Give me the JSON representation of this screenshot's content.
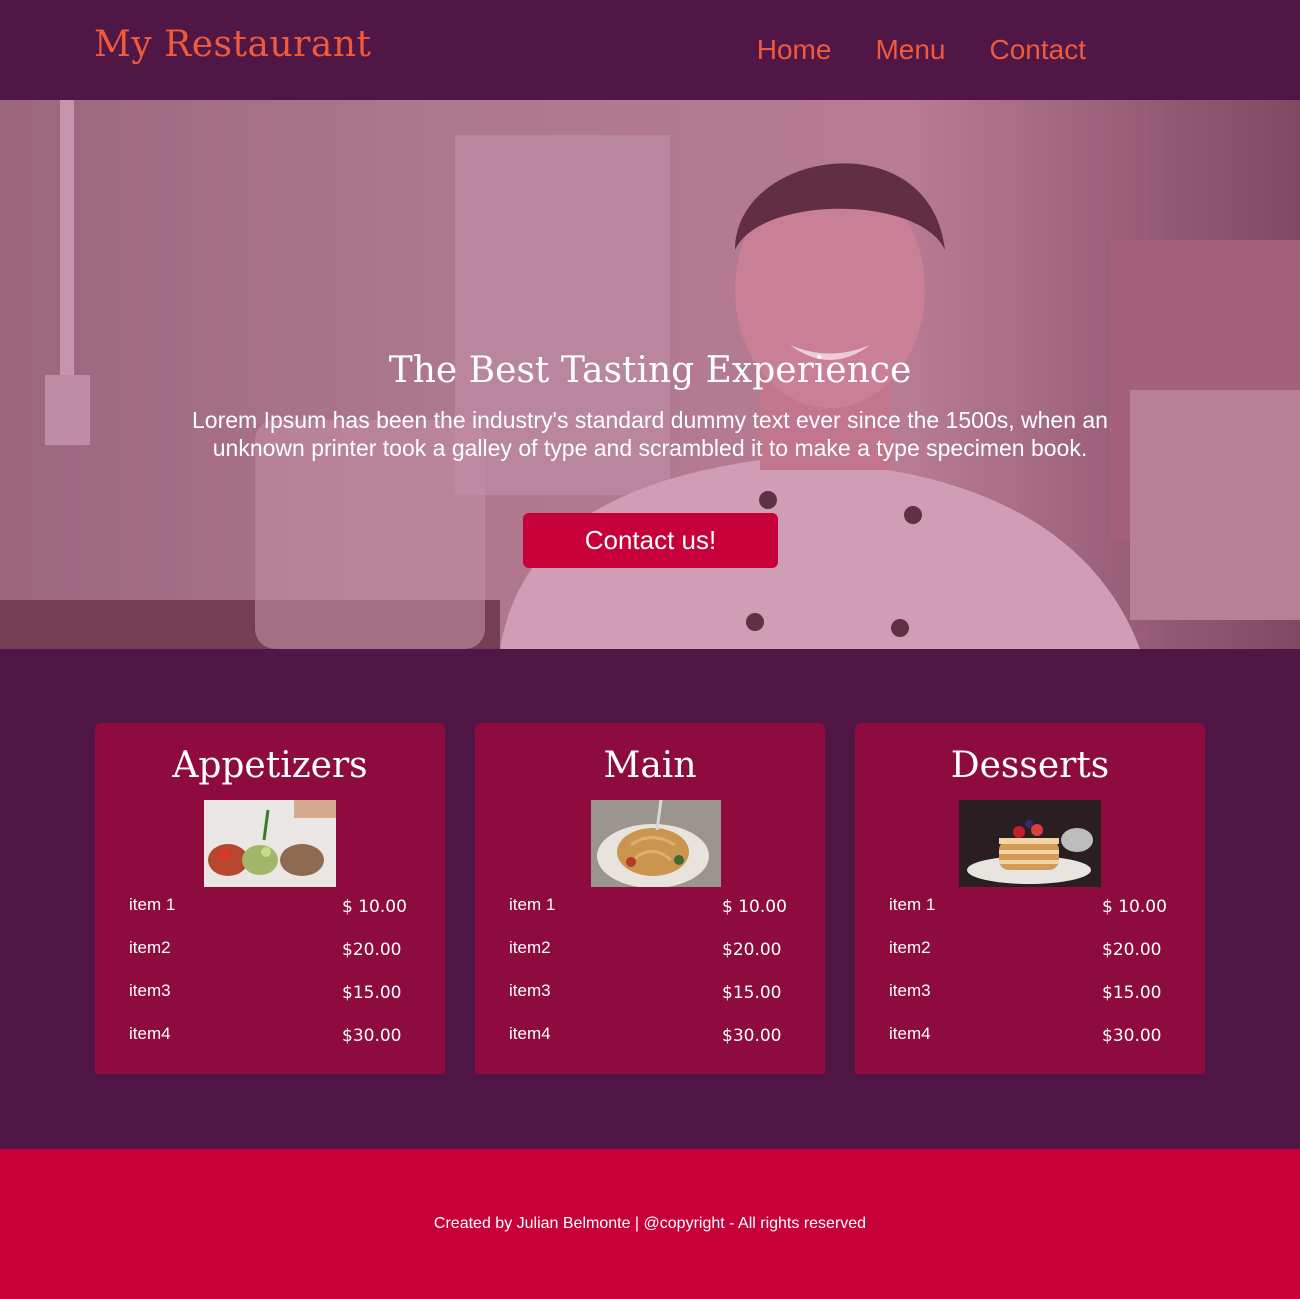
{
  "nav": {
    "brand": "My Restaurant",
    "links": [
      "Home",
      "Menu",
      "Contact"
    ]
  },
  "hero": {
    "title": "The Best Tasting Experience",
    "text": "Lorem Ipsum has been the industry's standard dummy text ever since the 1500s, when an unknown printer took a galley of type and scrambled it to make a type specimen book.",
    "button": "Contact us!"
  },
  "menu": [
    {
      "title": "Appetizers",
      "image": "appetizers-photo",
      "items": [
        {
          "name": "item 1",
          "price": "$ 10.00"
        },
        {
          "name": "item2",
          "price": "$20.00"
        },
        {
          "name": "item3",
          "price": "$15.00"
        },
        {
          "name": "item4",
          "price": "$30.00"
        }
      ]
    },
    {
      "title": "Main",
      "image": "pasta-photo",
      "items": [
        {
          "name": "item 1",
          "price": "$ 10.00"
        },
        {
          "name": "item2",
          "price": "$20.00"
        },
        {
          "name": "item3",
          "price": "$15.00"
        },
        {
          "name": "item4",
          "price": "$30.00"
        }
      ]
    },
    {
      "title": "Desserts",
      "image": "pancakes-photo",
      "items": [
        {
          "name": "item 1",
          "price": "$ 10.00"
        },
        {
          "name": "item2",
          "price": "$20.00"
        },
        {
          "name": "item3",
          "price": "$15.00"
        },
        {
          "name": "item4",
          "price": "$30.00"
        }
      ]
    }
  ],
  "footer": {
    "text": "Created by Julian Belmonte | @copyright - All rights reserved"
  },
  "colors": {
    "background": "#4f1646",
    "accent": "#f05a3c",
    "card": "#8e0b3d",
    "button": "#c8003a",
    "footer": "#c8003a"
  }
}
